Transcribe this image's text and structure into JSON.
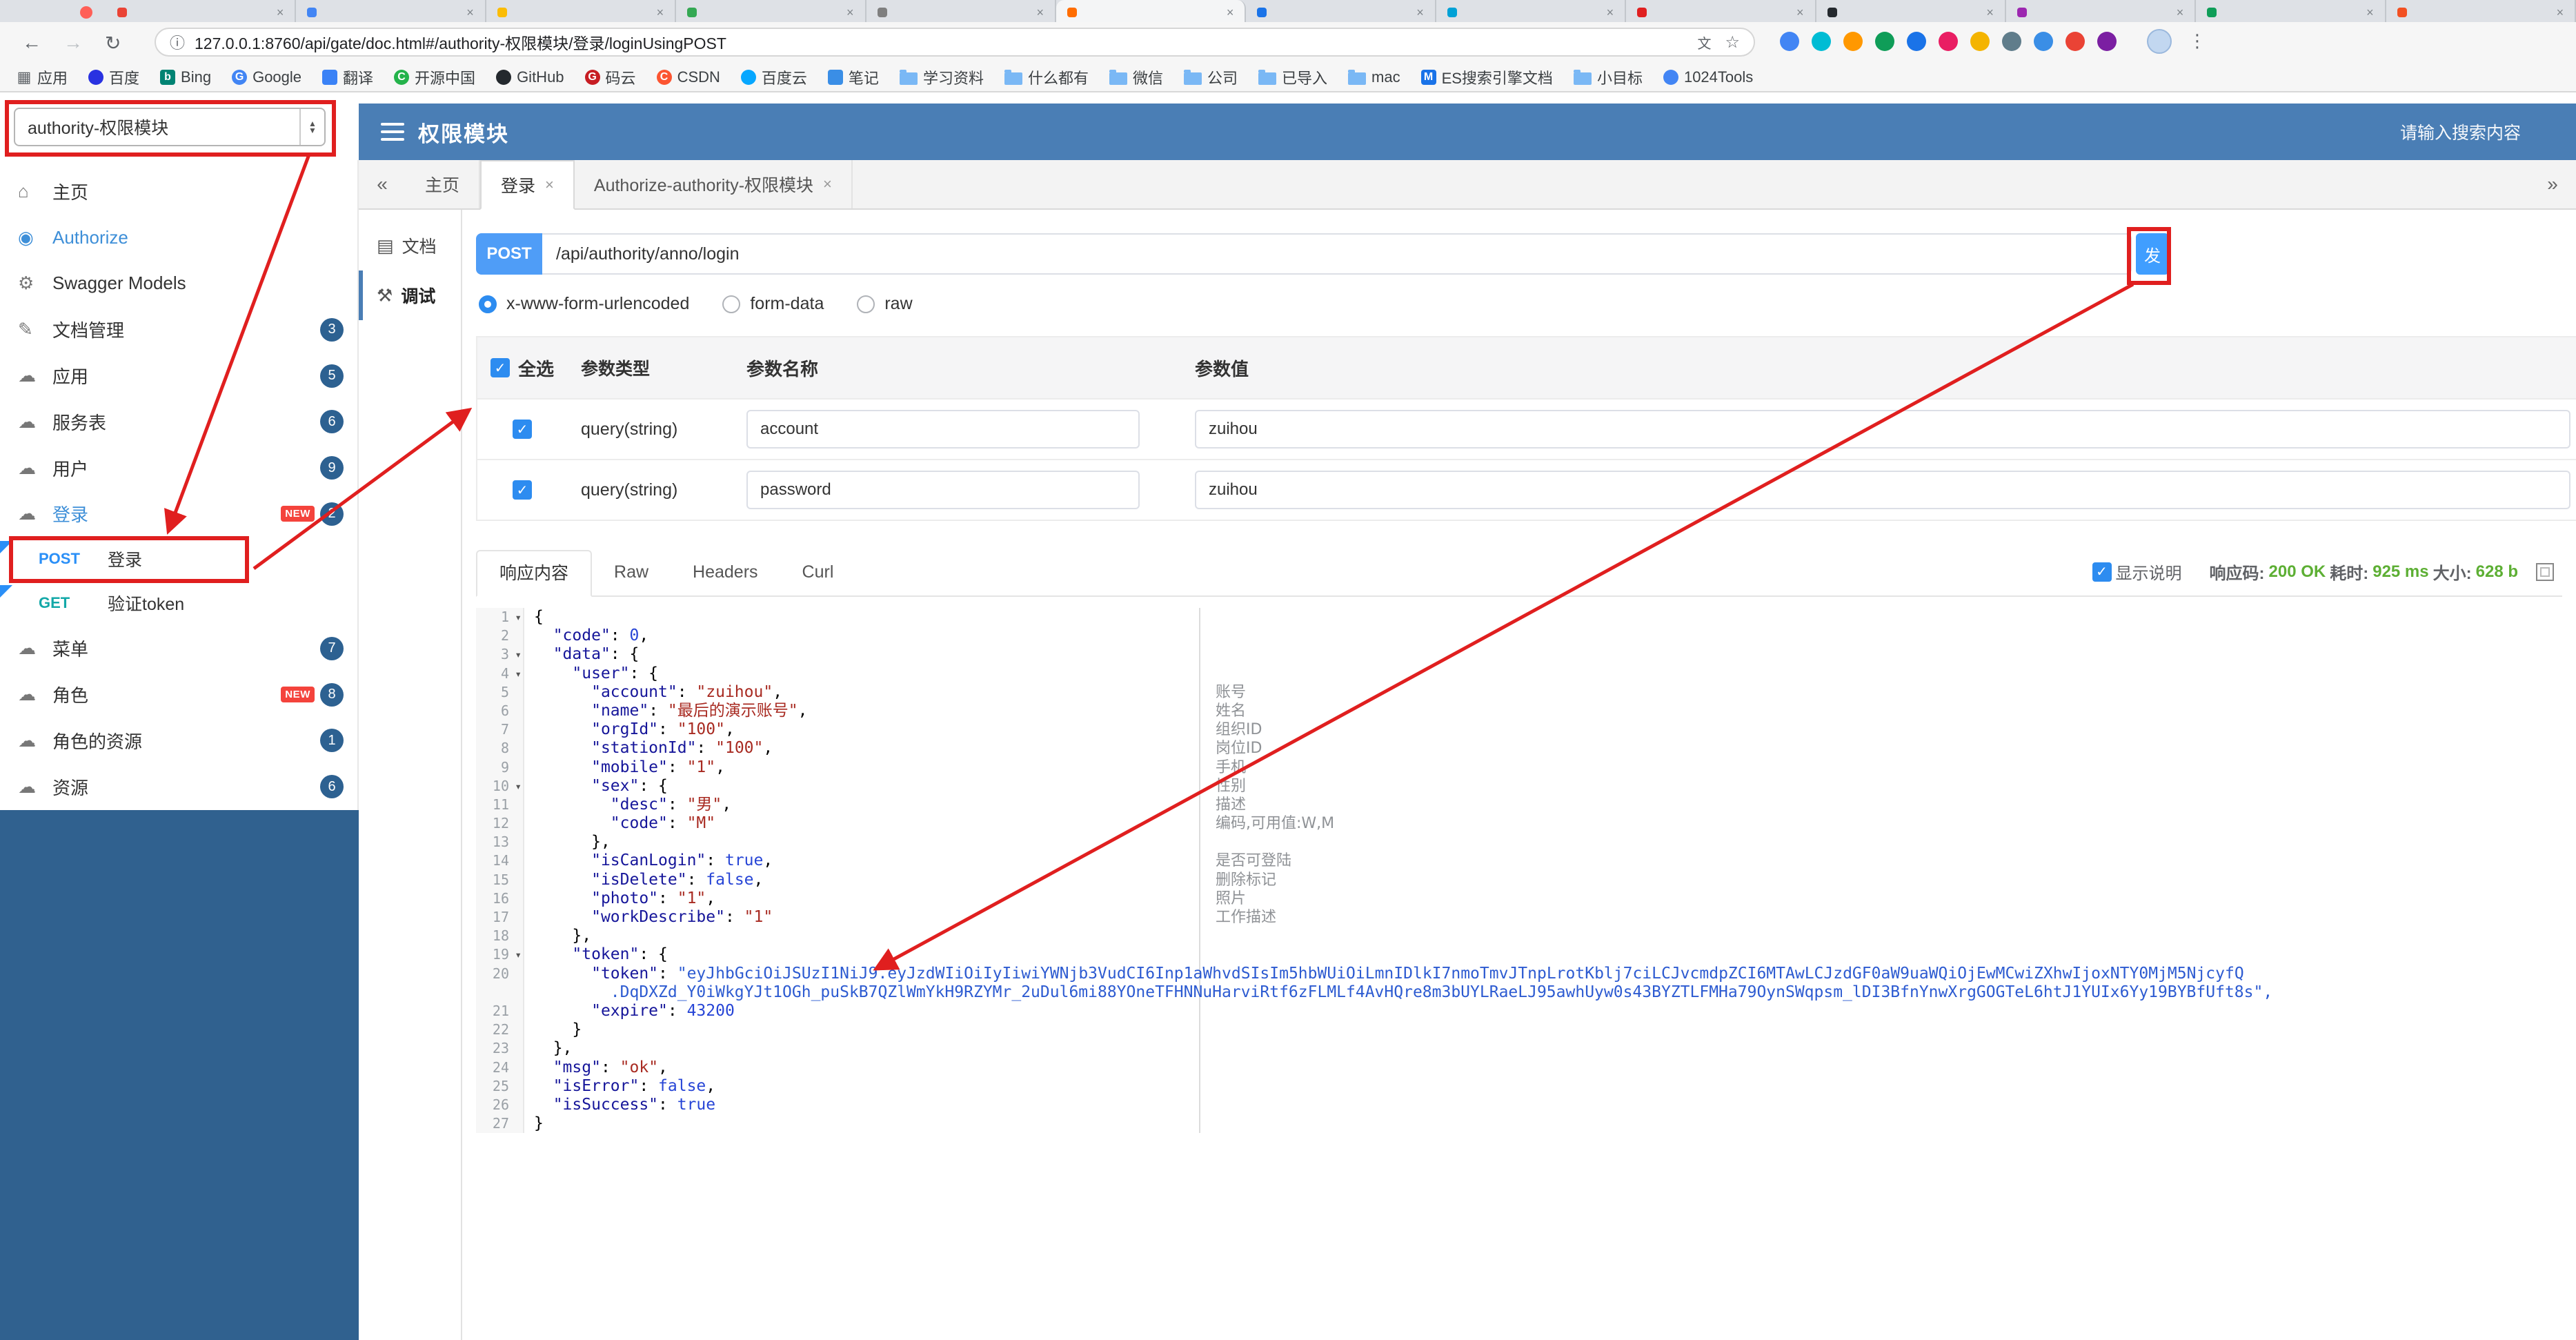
{
  "browser": {
    "window_controls": {
      "close_color": "#ff5f57"
    },
    "tabs": {
      "count": 13,
      "favicon_colors": [
        "#ea4335",
        "#4285f4",
        "#fbbc05",
        "#34a853",
        "#7f7f7f",
        "#ff6d00",
        "#1a73e8",
        "#00a1d6",
        "#e02020",
        "#24292e",
        "#9c27b0",
        "#0f9d58",
        "#f25022"
      ]
    },
    "url": "127.0.0.1:8760/api/gate/doc.html#/authority-权限模块/登录/loginUsingPOST",
    "extension_colors": [
      "#4285f4",
      "#00bcd4",
      "#ff9800",
      "#0f9d58",
      "#1a73e8",
      "#e91e63",
      "#f4b400",
      "#607d8b",
      "#3a8ee6",
      "#ea4335",
      "#7b1fa2"
    ],
    "bookmarks": [
      {
        "label": "应用",
        "glyph": "▦",
        "color": "#5f6368",
        "plain": true
      },
      {
        "label": "百度",
        "color": "#2932e1",
        "round": true
      },
      {
        "label": "Bing",
        "glyph": "b",
        "color": "#008373"
      },
      {
        "label": "Google",
        "glyph": "G",
        "color": "#4285f4",
        "round": true
      },
      {
        "label": "翻译",
        "color": "#3b82f6"
      },
      {
        "label": "开源中国",
        "glyph": "C",
        "color": "#24b34b",
        "round": true
      },
      {
        "label": "GitHub",
        "color": "#24292e",
        "round": true
      },
      {
        "label": "码云",
        "glyph": "G",
        "color": "#c71d23",
        "round": true
      },
      {
        "label": "CSDN",
        "glyph": "C",
        "color": "#fc5531",
        "round": true
      },
      {
        "label": "百度云",
        "color": "#06a7ff",
        "round": true
      },
      {
        "label": "笔记",
        "color": "#3a8ee6"
      },
      {
        "label": "学习资料",
        "folder": true
      },
      {
        "label": "什么都有",
        "folder": true
      },
      {
        "label": "微信",
        "folder": true
      },
      {
        "label": "公司",
        "folder": true
      },
      {
        "label": "已导入",
        "folder": true
      },
      {
        "label": "mac",
        "folder": true
      },
      {
        "label": "ES搜索引擎文档",
        "glyph": "M",
        "color": "#1a73e8"
      },
      {
        "label": "小目标",
        "folder": true
      },
      {
        "label": "1024Tools",
        "color": "#4285f4",
        "round": true
      }
    ]
  },
  "app": {
    "module_select": "authority-权限模块",
    "header": {
      "title": "权限模块",
      "search_placeholder": "请输入搜索内容"
    },
    "sidebar": {
      "new_tag": "NEW",
      "items": [
        {
          "label": "主页",
          "icon": "home"
        },
        {
          "label": "Authorize",
          "icon": "auth",
          "accent": true
        },
        {
          "label": "Swagger Models",
          "icon": "models"
        },
        {
          "label": "文档管理",
          "icon": "docs",
          "badge": 3
        },
        {
          "label": "应用",
          "icon": "cloud",
          "badge": 5
        },
        {
          "label": "服务表",
          "icon": "cloud",
          "badge": 6
        },
        {
          "label": "用户",
          "icon": "cloud",
          "badge": 9
        },
        {
          "label": "登录",
          "icon": "cloud",
          "badge": 2,
          "isNew": true,
          "active": true
        },
        {
          "label": "登录",
          "method": "POST"
        },
        {
          "label": "验证token",
          "method": "GET"
        },
        {
          "label": "菜单",
          "icon": "cloud",
          "badge": 7
        },
        {
          "label": "角色",
          "icon": "cloud",
          "badge": 8,
          "isNew": true
        },
        {
          "label": "角色的资源",
          "icon": "cloud",
          "badge": 1
        },
        {
          "label": "资源",
          "icon": "cloud",
          "badge": 6
        }
      ]
    },
    "open_tabs": [
      {
        "label": "主页"
      },
      {
        "label": "登录",
        "close": true,
        "active": true
      },
      {
        "label": "Authorize-authority-权限模块",
        "close": true
      }
    ],
    "doc_nav": [
      {
        "label": "文档",
        "icon": "doc"
      },
      {
        "label": "调试",
        "icon": "debug",
        "active": true
      }
    ],
    "request": {
      "method": "POST",
      "url": "/api/authority/anno/login",
      "send_label": "发"
    },
    "content_types": [
      {
        "label": "x-www-form-urlencoded",
        "selected": true
      },
      {
        "label": "form-data"
      },
      {
        "label": "raw"
      }
    ],
    "params_table": {
      "headers": [
        "全选",
        "参数类型",
        "参数名称",
        "参数值"
      ],
      "rows": [
        {
          "checked": true,
          "type": "query(string)",
          "name": "account",
          "value": "zuihou"
        },
        {
          "checked": true,
          "type": "query(string)",
          "name": "password",
          "value": "zuihou"
        }
      ]
    },
    "response": {
      "tabs": [
        "响应内容",
        "Raw",
        "Headers",
        "Curl"
      ],
      "active_tab": "响应内容",
      "show_desc_label": "显示说明",
      "status_label": "响应码:",
      "status_value": "200 OK",
      "time_label": "耗时:",
      "time_value": "925 ms",
      "size_label": "大小:",
      "size_value": "628 b",
      "status_color": "#5daf34",
      "code_lines": [
        {
          "n": 1,
          "fold": true,
          "text": "{"
        },
        {
          "n": 2,
          "text": "  \"code\": 0,"
        },
        {
          "n": 3,
          "fold": true,
          "text": "  \"data\": {"
        },
        {
          "n": 4,
          "fold": true,
          "text": "    \"user\": {"
        },
        {
          "n": 5,
          "text": "      \"account\": \"zuihou\",",
          "comment": "账号"
        },
        {
          "n": 6,
          "text": "      \"name\": \"最后的演示账号\",",
          "comment": "姓名"
        },
        {
          "n": 7,
          "text": "      \"orgId\": \"100\",",
          "comment": "组织ID"
        },
        {
          "n": 8,
          "text": "      \"stationId\": \"100\",",
          "comment": "岗位ID"
        },
        {
          "n": 9,
          "text": "      \"mobile\": \"1\",",
          "comment": "手机"
        },
        {
          "n": 10,
          "fold": true,
          "text": "      \"sex\": {",
          "comment": "性别"
        },
        {
          "n": 11,
          "text": "        \"desc\": \"男\",",
          "comment": "描述"
        },
        {
          "n": 12,
          "text": "        \"code\": \"M\"",
          "comment": "编码,可用值:W,M"
        },
        {
          "n": 13,
          "text": "      },"
        },
        {
          "n": 14,
          "text": "      \"isCanLogin\": true,",
          "comment": "是否可登陆"
        },
        {
          "n": 15,
          "text": "      \"isDelete\": false,",
          "comment": "删除标记"
        },
        {
          "n": 16,
          "text": "      \"photo\": \"1\",",
          "comment": "照片"
        },
        {
          "n": 17,
          "text": "      \"workDescribe\": \"1\"",
          "comment": "工作描述"
        },
        {
          "n": 18,
          "text": "    },"
        },
        {
          "n": 19,
          "fold": true,
          "text": "    \"token\": {"
        },
        {
          "n": 20,
          "segs": [
            [
              "",
              "      "
            ],
            [
              "k",
              "\"token\""
            ],
            [
              "",
              ": "
            ],
            [
              "t",
              "\"eyJhbGciOiJSUzI1NiJ9.eyJzdWIiOiIyIiwiYWNjb3VudCI6Inp1aWhvdSIsIm5hbWUiOiLmnIDlkI7nmoTmvJTnpLrotKblj7ciLCJvcmdpZCI6MTAwLCJzdGF0aW9uaWQiOjEwMCwiZXhwIjoxNTY0MjM5NjcyfQ"
            ]
          ]
        },
        {
          "wrap": true,
          "segs": [
            [
              "t",
              "        .DqDXZd_Y0iWkgYJt1OGh_puSkB7QZlWmYkH9RZYMr_2uDul6mi88YOneTFHNNuHarviRtf6zFLMLf4AvHQre8m3bUYLRaeLJ95awhUyw0s43BYZTLFMHa79OynSWqpsm_lDI3BfnYnwXrgGOGTeL6htJ1YUIx6Yy19BYBfUft8s\","
            ]
          ]
        },
        {
          "n": 21,
          "text": "      \"expire\": 43200"
        },
        {
          "n": 22,
          "text": "    }"
        },
        {
          "n": 23,
          "text": "  },"
        },
        {
          "n": 24,
          "text": "  \"msg\": \"ok\","
        },
        {
          "n": 25,
          "text": "  \"isError\": false,"
        },
        {
          "n": 26,
          "text": "  \"isSuccess\": true"
        },
        {
          "n": 27,
          "text": "}"
        }
      ]
    },
    "colors": {
      "header_blue": "#4a7eb5",
      "sidebar_fill": "#30618f",
      "accent_blue": "#3e8fd8",
      "method_post": "#2a8ff7",
      "method_get": "#13a8a8",
      "annotation_red": "#e01f1f"
    }
  }
}
